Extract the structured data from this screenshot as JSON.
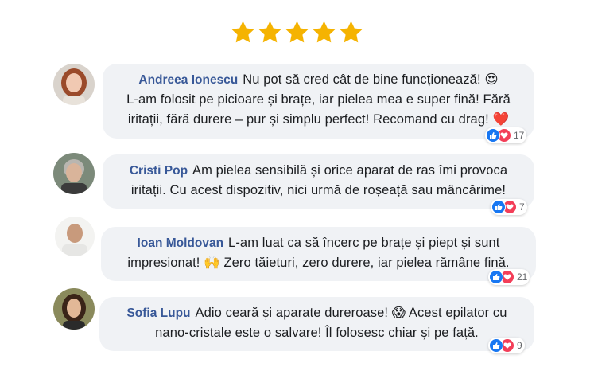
{
  "rating": {
    "stars": 5,
    "max": 5,
    "color": "#f5b301"
  },
  "colors": {
    "name": "#385898",
    "bubble": "#f0f2f5",
    "like": "#1877f2",
    "love": "#f33e58"
  },
  "comments": [
    {
      "name": "Andreea Ionescu",
      "lines": [
        "Nu pot să cred cât de bine funcționează! 😍",
        "L-am folosit pe picioare și brațe, iar pielea mea e super fină! Fără",
        "iritații, fără durere – pur și simplu perfect! Recomand cu drag! ❤️"
      ],
      "reactions": "17",
      "avatar": "woman-red-hair-avatar"
    },
    {
      "name": "Cristi Pop",
      "lines": [
        "Am pielea sensibilă și orice aparat de ras îmi provoca",
        "iritații. Cu acest dispozitiv, nici urmă de roșeață sau mâncărime!"
      ],
      "reactions": "7",
      "avatar": "man-grey-hair-avatar"
    },
    {
      "name": "Ioan Moldovan",
      "lines": [
        "L-am luat ca să încerc pe brațe și piept și sunt",
        "impresionat! 🙌 Zero tăieturi, zero durere, iar pielea rămâne fină."
      ],
      "reactions": "21",
      "avatar": "man-bald-avatar"
    },
    {
      "name": "Sofia Lupu",
      "lines": [
        "Adio ceară și aparate dureroase! 😱 Acest epilator cu",
        "nano-cristale este o salvare! Îl folosesc chiar și pe față."
      ],
      "reactions": "9",
      "avatar": "woman-dark-hair-avatar"
    }
  ]
}
